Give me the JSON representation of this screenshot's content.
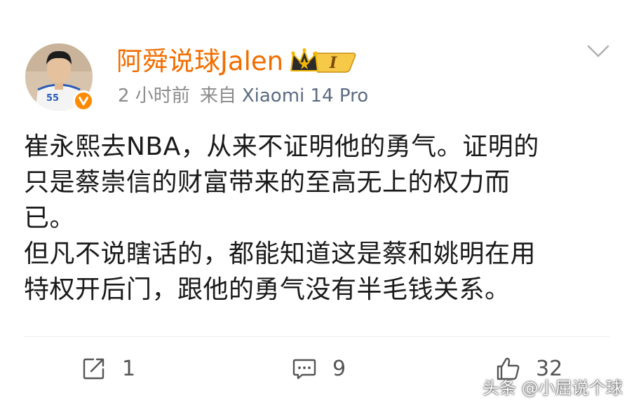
{
  "post": {
    "author": "阿舜说球Jalen",
    "level_badge": "I",
    "time": "2 小时前",
    "source_prefix": "来自",
    "device": "Xiaomi 14 Pro",
    "jersey_number": "55",
    "paragraph_1": "崔永熙去NBA，从来不证明他的勇气。证明的\n只是蔡崇信的财富带来的至高无上的权力而\n已。",
    "paragraph_2": "但凡不说瞎话的，都能知道这是蔡和姚明在用\n特权开后门，跟他的勇气没有半毛钱关系。"
  },
  "actions": {
    "repost_count": "1",
    "comment_count": "9",
    "like_count": "32"
  },
  "watermark": "头条 @小屈说个球",
  "colors": {
    "author_name": "#f26d00",
    "verified_badge": "#ff8a00",
    "device_text": "#5b6b82"
  },
  "icons": {
    "verified": "verified-v-icon",
    "level": "crown-level-icon",
    "menu": "chevron-down-icon",
    "repost": "repost-icon",
    "comment": "comment-icon",
    "like": "thumbs-up-icon"
  }
}
